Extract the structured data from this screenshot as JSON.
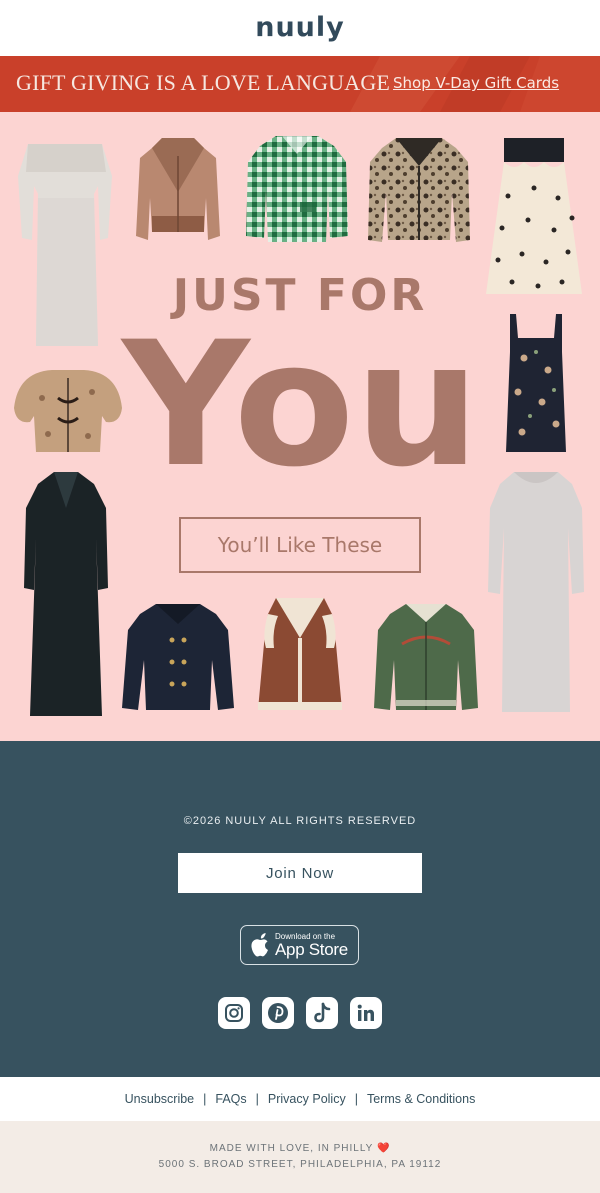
{
  "header": {
    "logo": "nuuly"
  },
  "banner": {
    "title": "GIFT GIVING IS A LOVE LANGUAGE",
    "link": "Shop V-Day Gift Cards"
  },
  "hero": {
    "headline_top": "JUST FOR",
    "headline_main": "You",
    "cta": "You’ll Like These",
    "products": [
      "off-shoulder-knit-dress",
      "faux-fur-jacket",
      "green-gingham-shirt",
      "leopard-denim-jacket",
      "bow-print-skirt",
      "floral-puff-top",
      "floral-mini-dress",
      "black-maxi-dress",
      "navy-button-jacket",
      "shearling-vest",
      "green-embroidered-jacket",
      "grey-knit-dress"
    ]
  },
  "footer": {
    "copyright": "©2026 NUULY ALL RIGHTS RESERVED",
    "join": "Join Now",
    "appstore_small": "Download on the",
    "appstore_big": "App Store",
    "socials": [
      "instagram-icon",
      "pinterest-icon",
      "tiktok-icon",
      "linkedin-icon"
    ]
  },
  "links": {
    "unsubscribe": "Unsubscribe",
    "faqs": "FAQs",
    "privacy": "Privacy Policy",
    "terms": "Terms & Conditions",
    "separator": "|"
  },
  "bottom": {
    "made": "MADE WITH LOVE, IN PHILLY ❤️",
    "address": "5000 S. BROAD STREET, PHILADELPHIA, PA 19112"
  },
  "colors": {
    "banner": "#c9402a",
    "hero_bg": "#fcd4d2",
    "headline": "#a9786a",
    "footer_bg": "#37525f",
    "bottom_bg": "#f3ece6"
  }
}
